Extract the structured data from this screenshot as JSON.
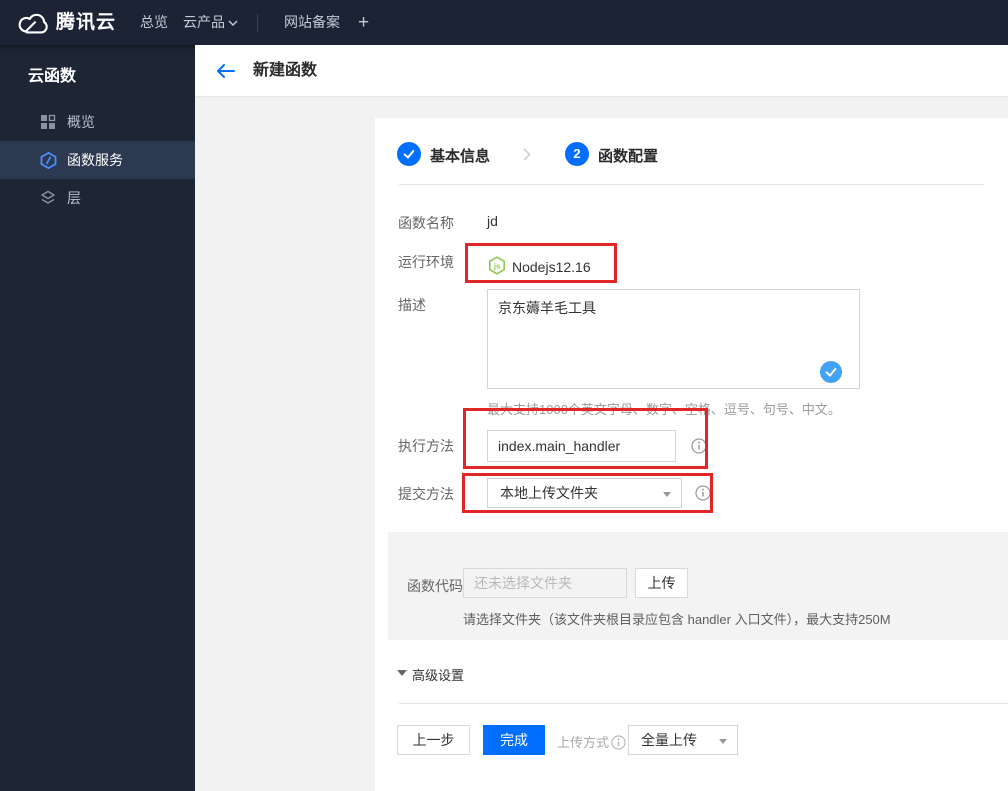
{
  "topbar": {
    "brand": "腾讯云",
    "items": [
      {
        "label": "总览"
      },
      {
        "label": "云产品"
      },
      {
        "label": "网站备案"
      },
      {
        "label": "+"
      }
    ]
  },
  "sidebar": {
    "title": "云函数",
    "items": [
      {
        "label": "概览",
        "icon": "grid-icon",
        "active": false
      },
      {
        "label": "函数服务",
        "icon": "scf-hexagon-icon",
        "active": true
      },
      {
        "label": "层",
        "icon": "layers-icon",
        "active": false
      }
    ]
  },
  "header": {
    "title": "新建函数"
  },
  "steps": {
    "step1": {
      "label": "基本信息",
      "state": "done"
    },
    "step2": {
      "num": "2",
      "label": "函数配置",
      "state": "current"
    }
  },
  "form": {
    "name": {
      "label": "函数名称",
      "value": "jd"
    },
    "runtime": {
      "label": "运行环境",
      "value": "Nodejs12.16"
    },
    "desc": {
      "label": "描述",
      "value": "京东薅羊毛工具",
      "hint": "最大支持1000个英文字母、数字、空格、逗号、句号、中文。"
    },
    "handler": {
      "label": "执行方法",
      "value": "index.main_handler"
    },
    "submit_method": {
      "label": "提交方法",
      "value": "本地上传文件夹"
    },
    "code": {
      "label": "函数代码",
      "required_mark": "*",
      "placeholder": "还未选择文件夹",
      "upload_label": "上传",
      "hint": "请选择文件夹（该文件夹根目录应包含 handler 入口文件），最大支持250M"
    },
    "advanced_label": "高级设置"
  },
  "footer": {
    "prev_label": "上一步",
    "finish_label": "完成",
    "upload_mode_label": "上传方式",
    "upload_mode_value": "全量上传"
  },
  "colors": {
    "accent_blue": "#006eff",
    "annotation_red": "#e02626",
    "node_green": "#8cc84b",
    "valid_check_blue": "#42a2f5",
    "topbar_dark": "#1b2334",
    "sidebar_dark": "#1e2635"
  }
}
